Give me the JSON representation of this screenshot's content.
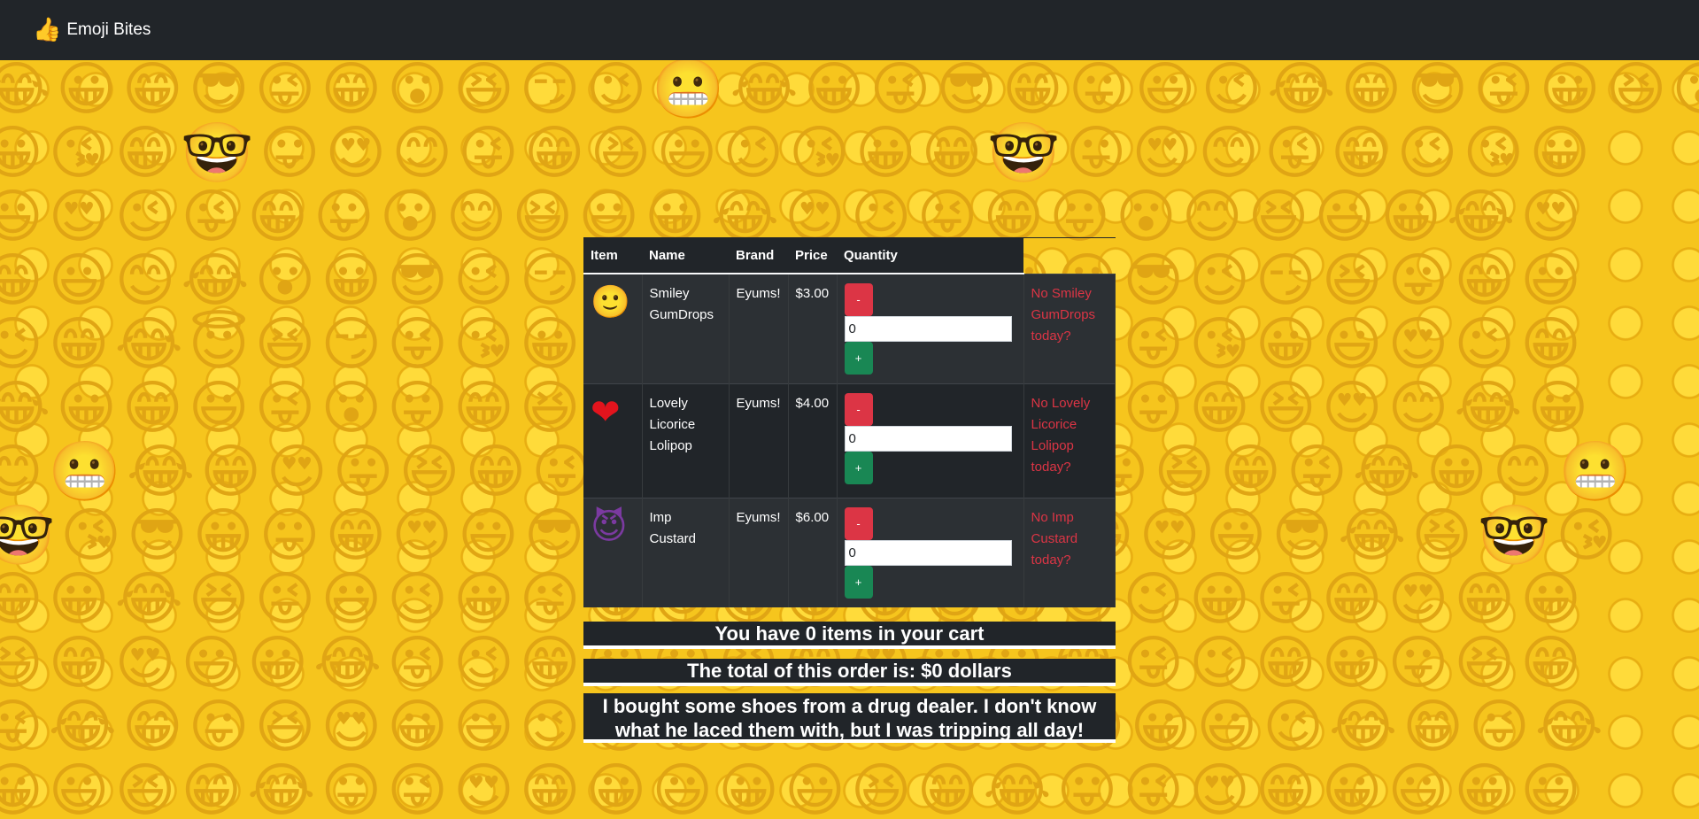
{
  "navbar": {
    "brand_icon": "thumbs-up-icon",
    "brand_icon_glyph": "👍",
    "brand_label": "Emoji Bites"
  },
  "table": {
    "headers": [
      "Item",
      "Name",
      "Brand",
      "Price",
      "Quantity"
    ],
    "rows": [
      {
        "icon": "smiley-emoji-icon",
        "glyph": "🙂",
        "name": "Smiley GumDrops",
        "brand": "Eyums!",
        "price": "$3.00",
        "minus_label": "-",
        "quantity": "0",
        "plus_label": "+",
        "status": "No Smiley GumDrops today?"
      },
      {
        "icon": "heart-emoji-icon",
        "glyph": "❤",
        "name": "Lovely Licorice Lolipop",
        "brand": "Eyums!",
        "price": "$4.00",
        "minus_label": "-",
        "quantity": "0",
        "plus_label": "+",
        "status": "No Lovely Licorice Lolipop today?"
      },
      {
        "icon": "imp-emoji-icon",
        "glyph": "😈",
        "name": "Imp Custard",
        "brand": "Eyums!",
        "price": "$6.00",
        "minus_label": "-",
        "quantity": "0",
        "plus_label": "+",
        "status": "No Imp Custard today?"
      }
    ]
  },
  "summary": {
    "items_text": "You have 0 items in your cart",
    "total_text": "The total of this order is: $0 dollars",
    "joke_text": "I bought some shoes from a drug dealer. I don't know what he laced them with, but I was tripping all day!"
  },
  "colors": {
    "navbar_bg": "#212529",
    "danger": "#dc3545",
    "success": "#198754",
    "background": "#f6c51d"
  }
}
